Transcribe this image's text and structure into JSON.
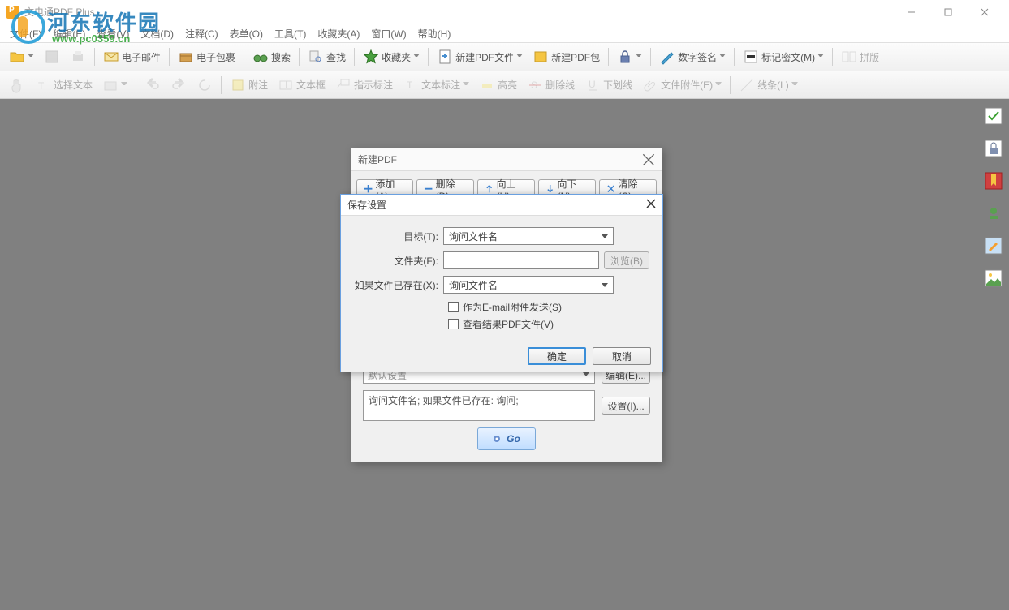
{
  "app": {
    "title": "文电通PDF Plus"
  },
  "watermark": {
    "brand": "河东软件园",
    "url": "www.pc0359.cn"
  },
  "menubar": [
    "文件(F)",
    "编辑(E)",
    "查看(V)",
    "文档(D)",
    "注释(C)",
    "表单(O)",
    "工具(T)",
    "收藏夹(A)",
    "窗口(W)",
    "帮助(H)"
  ],
  "toolbar1": {
    "open": "打开",
    "email": "电子邮件",
    "package": "电子包裹",
    "search": "搜索",
    "find": "查找",
    "favorites": "收藏夹",
    "newpdf": "新建PDF文件",
    "newpkg": "新建PDF包",
    "sign": "数字签名",
    "redact": "标记密文(M)",
    "sidebyside": "拼版"
  },
  "toolbar2": {
    "select": "选择文本",
    "attach": "附注",
    "textbox": "文本框",
    "callout": "指示标注",
    "textmark": "文本标注",
    "highlight": "高亮",
    "strike": "删除线",
    "underline": "下划线",
    "fileattach": "文件附件(E)",
    "line": "线条(L)"
  },
  "dialog_back": {
    "title": "新建PDF",
    "tabs": {
      "add": "添加(A)",
      "delete": "删除(D)",
      "up": "向上(U)",
      "down": "向下(N)",
      "clear": "清除(C)"
    },
    "select_hidden": "默认设置",
    "edit_btn": "编辑(E)...",
    "info_text": "询问文件名; 如果文件已存在: 询问;",
    "settings_btn": "设置(I)...",
    "go": "Go"
  },
  "dialog_front": {
    "title": "保存设置",
    "target_label": "目标(T):",
    "target_value": "询问文件名",
    "folder_label": "文件夹(F):",
    "browse": "浏览(B)",
    "exists_label": "如果文件已存在(X):",
    "exists_value": "询问文件名",
    "check_email": "作为E-mail附件发送(S)",
    "check_view": "查看结果PDF文件(V)",
    "ok": "确定",
    "cancel": "取消"
  }
}
